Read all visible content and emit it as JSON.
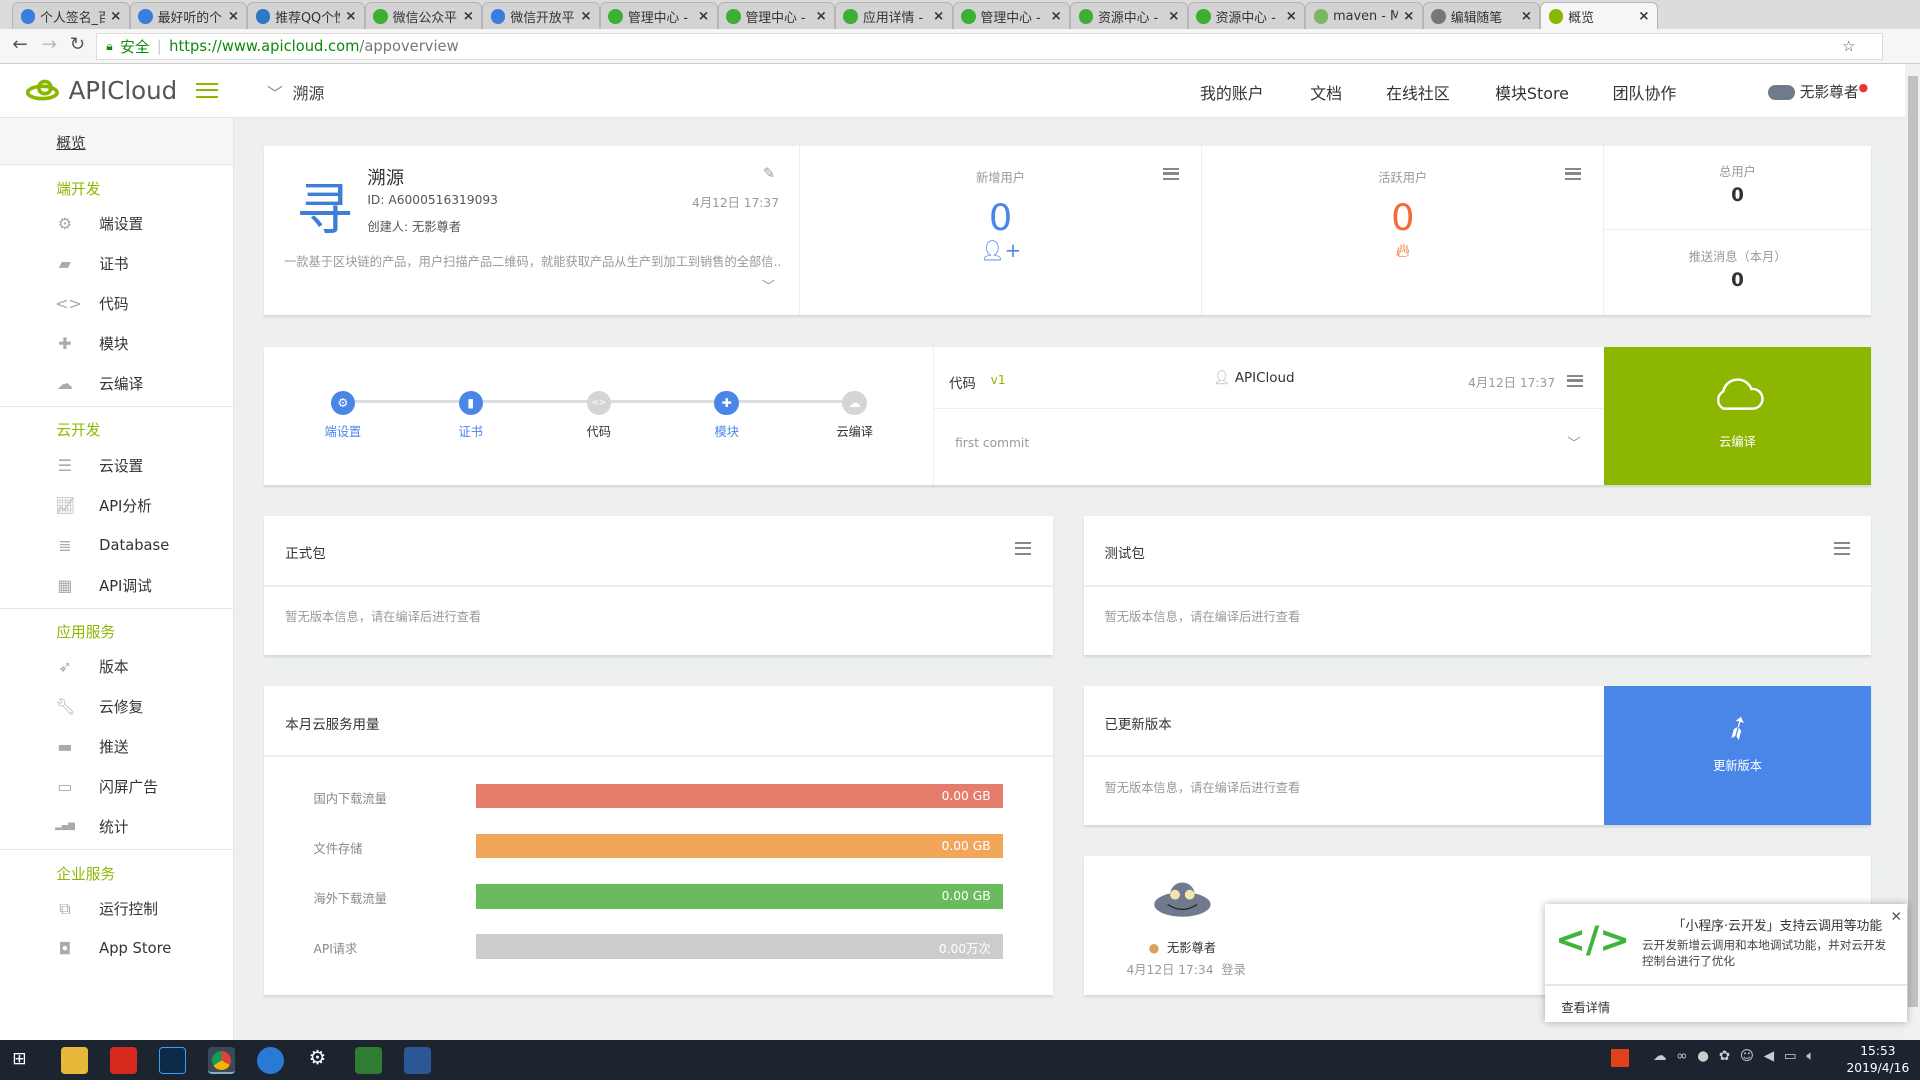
{
  "browser": {
    "tabs": [
      {
        "title": "个人签名_百",
        "icon": "baidu-icon",
        "color": "#3a7de0"
      },
      {
        "title": "最好听的个",
        "icon": "baidu-icon",
        "color": "#3a7de0"
      },
      {
        "title": "推荐QQ个性",
        "icon": "qq-search-icon",
        "color": "#2b78c5"
      },
      {
        "title": "微信公众平",
        "icon": "wechat-icon",
        "color": "#3cb034"
      },
      {
        "title": "微信开放平",
        "icon": "baidu-icon",
        "color": "#3a7de0"
      },
      {
        "title": "管理中心 -",
        "icon": "wechat-icon",
        "color": "#3cb034"
      },
      {
        "title": "管理中心 -",
        "icon": "wechat-icon",
        "color": "#3cb034"
      },
      {
        "title": "应用详情 -",
        "icon": "wechat-icon",
        "color": "#3cb034"
      },
      {
        "title": "管理中心 -",
        "icon": "wechat-icon",
        "color": "#3cb034"
      },
      {
        "title": "资源中心 -",
        "icon": "wechat-icon",
        "color": "#3cb034"
      },
      {
        "title": "资源中心 -",
        "icon": "wechat-icon",
        "color": "#3cb034"
      },
      {
        "title": "maven - M",
        "icon": "anchor-icon",
        "color": "#7bb661"
      },
      {
        "title": "编辑随笔",
        "icon": "blog-icon",
        "color": "#777"
      },
      {
        "title": "概览",
        "icon": "apicloud-icon",
        "color": "#8ab800"
      }
    ],
    "secure_label": "安全",
    "url_host": "https://www.apicloud.com",
    "url_path": "/appoverview"
  },
  "header": {
    "brand": "APICloud",
    "breadcrumb": "溯源",
    "nav": [
      "我的账户",
      "文档",
      "在线社区",
      "模块Store",
      "团队协作"
    ],
    "user": "无影尊者",
    "accent": "#8ab800"
  },
  "sidebar": {
    "overview": "概览",
    "sections": [
      {
        "title": "端开发",
        "items": [
          {
            "label": "端设置",
            "icon": "gear-icon"
          },
          {
            "label": "证书",
            "icon": "certificate-icon"
          },
          {
            "label": "代码",
            "icon": "code-icon"
          },
          {
            "label": "模块",
            "icon": "puzzle-icon"
          },
          {
            "label": "云编译",
            "icon": "cloud-icon"
          }
        ]
      },
      {
        "title": "云开发",
        "items": [
          {
            "label": "云设置",
            "icon": "sliders-icon"
          },
          {
            "label": "API分析",
            "icon": "chart-line-icon"
          },
          {
            "label": "Database",
            "icon": "database-icon"
          },
          {
            "label": "API调试",
            "icon": "debug-icon"
          }
        ]
      },
      {
        "title": "应用服务",
        "items": [
          {
            "label": "版本",
            "icon": "rocket-icon"
          },
          {
            "label": "云修复",
            "icon": "wrench-icon"
          },
          {
            "label": "推送",
            "icon": "push-icon"
          },
          {
            "label": "闪屏广告",
            "icon": "ad-icon"
          },
          {
            "label": "统计",
            "icon": "bar-chart-icon"
          }
        ]
      },
      {
        "title": "企业服务",
        "items": [
          {
            "label": "运行控制",
            "icon": "windows-icon"
          },
          {
            "label": "App Store",
            "icon": "store-icon"
          }
        ]
      }
    ]
  },
  "app": {
    "name": "溯源",
    "id": "ID: A6000516319093",
    "creator": "创建人: 无影尊者",
    "date": "4月12日 17:37",
    "desc": "一款基于区块链的产品，用户扫描产品二维码，就能获取产品从生产到加工到销售的全部信..."
  },
  "stats": {
    "new_users": {
      "label": "新增用户",
      "value": "0",
      "color": "#4a86e8"
    },
    "active_users": {
      "label": "活跃用户",
      "value": "0",
      "color": "#f26b3a"
    },
    "total_users": {
      "label": "总用户",
      "value": "0"
    },
    "push_month": {
      "label": "推送消息（本月）",
      "value": "0"
    }
  },
  "steps": [
    {
      "label": "端设置",
      "done": true
    },
    {
      "label": "证书",
      "done": true
    },
    {
      "label": "代码",
      "done": false
    },
    {
      "label": "模块",
      "done": true
    },
    {
      "label": "云编译",
      "done": false
    }
  ],
  "code": {
    "title": "代码",
    "version": "v1",
    "author": "APICloud",
    "date": "4月12日 17:37",
    "commit": "first commit"
  },
  "compile_button": {
    "label": "云编译",
    "color": "#8db600"
  },
  "release_pkg": {
    "title": "正式包",
    "empty": "暂无版本信息，请在编译后进行查看"
  },
  "test_pkg": {
    "title": "测试包",
    "empty": "暂无版本信息，请在编译后进行查看"
  },
  "usage": {
    "title": "本月云服务用量",
    "rows": [
      {
        "label": "国内下载流量",
        "value": "0.00 GB",
        "color": "#e57c6c"
      },
      {
        "label": "文件存储",
        "value": "0.00 GB",
        "color": "#f2a65a"
      },
      {
        "label": "海外下载流量",
        "value": "0.00 GB",
        "color": "#6abb5e"
      },
      {
        "label": "API请求",
        "value": "0.00万次",
        "color": "#cccccc"
      }
    ]
  },
  "updated": {
    "title": "已更新版本",
    "empty": "暂无版本信息，请在编译后进行查看",
    "button": "更新版本",
    "color": "#4a86e8"
  },
  "activity": {
    "user": "无影尊者",
    "time": "4月12日 17:34",
    "action": "登录"
  },
  "notification": {
    "title": "「小程序·云开发」支持云调用等功能",
    "body": "云开发新增云调用和本地调试功能，并对云开发控制台进行了优化",
    "link": "查看详情"
  },
  "taskbar": {
    "time": "15:53",
    "date": "2019/4/16"
  }
}
